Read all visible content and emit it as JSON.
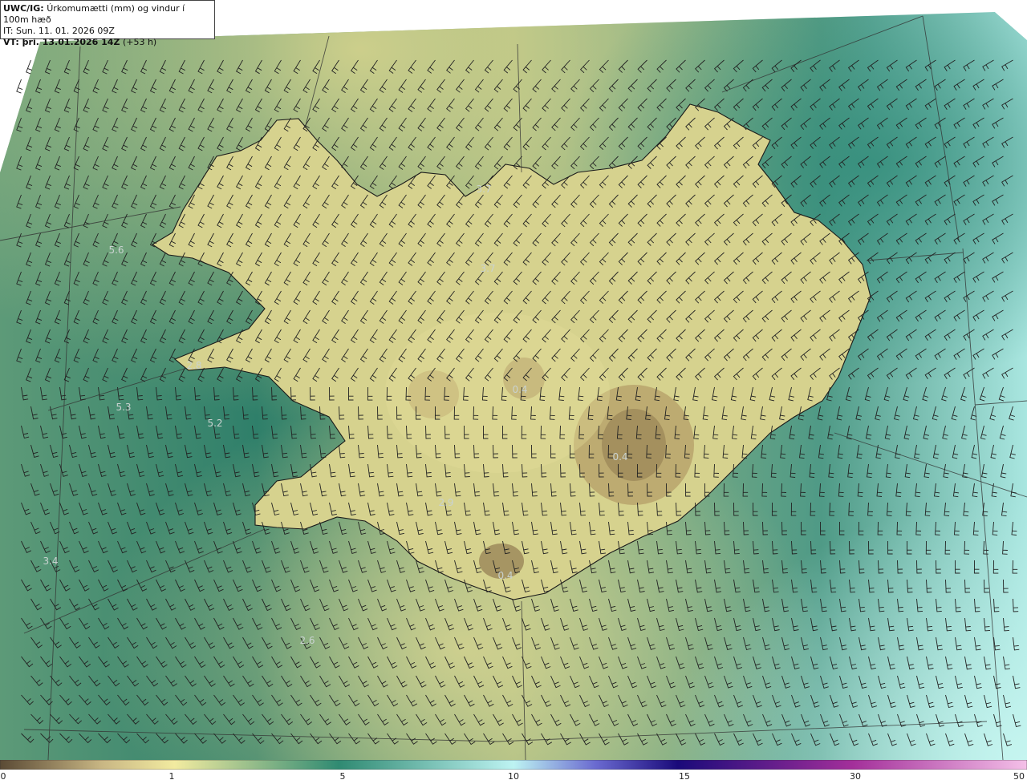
{
  "header": {
    "model": "UWC/IG:",
    "title": "Úrkomumætti (mm) og vindur í 100m hæð",
    "init_time": "IT: Sun. 11. 01. 2026 09Z",
    "valid_prefix": "VT: þri. 13.01.2026 14Z",
    "valid_suffix": "(+53 h)"
  },
  "value_labels": [
    {
      "text": "5.6"
    },
    {
      "text": "3.7"
    },
    {
      "text": "3.7"
    },
    {
      "text": "5.3"
    },
    {
      "text": "5.2"
    },
    {
      "text": "2.8"
    },
    {
      "text": "0.4"
    },
    {
      "text": "0.4"
    },
    {
      "text": "2.9"
    },
    {
      "text": "0.4"
    },
    {
      "text": "3.4"
    },
    {
      "text": "2.6"
    }
  ],
  "colorbar": {
    "ticks": [
      "0",
      "1",
      "5",
      "10",
      "15",
      "30",
      "50"
    ],
    "colors": [
      "#5a4a35",
      "#c9b784",
      "#f2eba0",
      "#2f8a72",
      "#bdf3f2",
      "#3f3fa8",
      "#1a0a7a",
      "#a32f9a",
      "#f4c0e8"
    ]
  },
  "map_colors": {
    "sea_dark": "#2f7f6a",
    "sea_mid": "#6aa67f",
    "land_light": "#d7d390",
    "highland": "#a89760",
    "coast": "#1a1a1a",
    "barb": "#222222",
    "grid": "#333333"
  }
}
